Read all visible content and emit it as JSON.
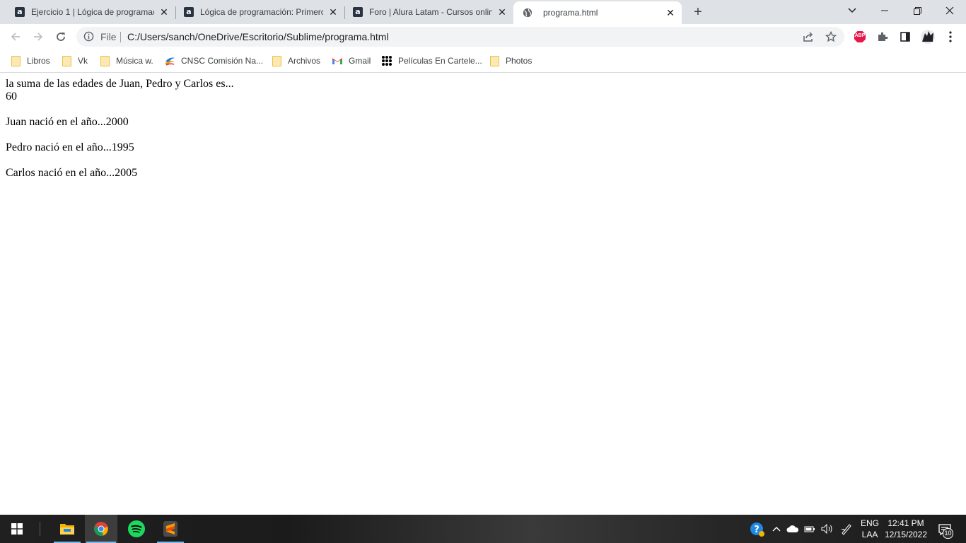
{
  "tabs": [
    {
      "title": "Ejercicio 1 | Lógica de programac",
      "favicon": "alura-icon"
    },
    {
      "title": "Lógica de programación: Primero",
      "favicon": "alura-icon"
    },
    {
      "title": "Foro | Alura Latam - Cursos onlin",
      "favicon": "alura-icon"
    },
    {
      "title": "programa.html",
      "favicon": "globe-icon",
      "active": true
    }
  ],
  "address_bar": {
    "scheme_label": "File",
    "url": "C:/Users/sanch/OneDrive/Escritorio/Sublime/programa.html"
  },
  "extensions": {
    "adblock_label": "ABP"
  },
  "bookmarks": [
    {
      "label": "Libros",
      "icon": "folder-icon"
    },
    {
      "label": "Vk",
      "icon": "folder-icon"
    },
    {
      "label": "Música w.",
      "icon": "folder-icon"
    },
    {
      "label": "CNSC Comisión Na...",
      "icon": "cnsc-icon"
    },
    {
      "label": "Archivos",
      "icon": "folder-icon"
    },
    {
      "label": "Gmail",
      "icon": "gmail-icon"
    },
    {
      "label": "Películas En Cartele...",
      "icon": "dots-icon"
    },
    {
      "label": "Photos",
      "icon": "folder-icon"
    }
  ],
  "page": {
    "lines": [
      "la suma de las edades de Juan, Pedro y Carlos es...",
      "60",
      "Juan nació en el año...2000",
      "Pedro nació en el año...1995",
      "Carlos nació en el año...2005"
    ]
  },
  "taskbar": {
    "language": "ENG",
    "layout": "LAA",
    "time": "12:41 PM",
    "date": "12/15/2022",
    "notification_count": "10"
  },
  "colors": {
    "tabstrip_bg": "#dee1e6",
    "omnibox_bg": "#f1f3f4",
    "taskbar_accent": "#76b9ed",
    "abp_red": "#e8174a"
  }
}
